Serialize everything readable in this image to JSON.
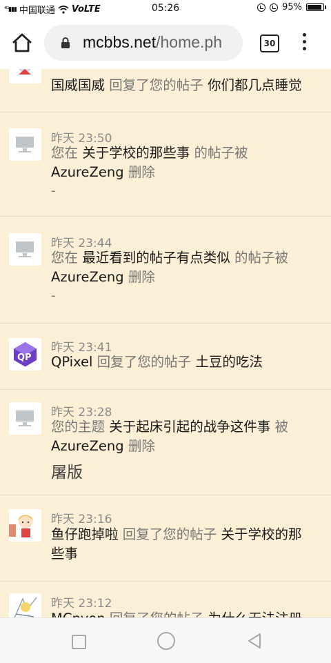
{
  "status": {
    "carrier": "中国联通",
    "volte": "VoLTE",
    "time": "05:26",
    "battery": "95%",
    "battery_level": 0.95
  },
  "browser": {
    "url_host": "mcbbs.net",
    "url_path": "/home.ph",
    "tab_count": "30"
  },
  "notifications": [
    {
      "avatar": "mascot",
      "time": "",
      "actor": "国威国威",
      "action": "回复了您的帖子",
      "target": "你们都几点睡觉",
      "line2": "",
      "note": ""
    },
    {
      "avatar": "monitor",
      "time": "昨天 23:50",
      "prefix": "您在",
      "target": "关于学校的那些事",
      "suffix": "的帖子被",
      "actor": "AzureZeng",
      "action": "删除",
      "note": "-"
    },
    {
      "avatar": "monitor",
      "time": "昨天 23:44",
      "prefix": "您在",
      "target": "最近看到的帖子有点类似",
      "suffix": "的帖子被",
      "actor": "AzureZeng",
      "action": "删除",
      "note": "-"
    },
    {
      "avatar": "qpixel",
      "time": "昨天 23:41",
      "actor": "QPixel",
      "action": "回复了您的帖子",
      "target": "土豆的吃法"
    },
    {
      "avatar": "monitor",
      "time": "昨天 23:28",
      "prefix": "您的主题",
      "target": "关于起床引起的战争这件事",
      "suffix": "被",
      "actor": "AzureZeng",
      "action": "删除",
      "note": "屠版"
    },
    {
      "avatar": "girl",
      "time": "昨天 23:16",
      "actor": "鱼仔跑掉啦",
      "action": "回复了您的帖子",
      "target": "关于学校的那",
      "target2": "些事"
    },
    {
      "avatar": "sketch",
      "time": "昨天 23:12",
      "actor": "MCpyon",
      "action": "回复了您的帖子",
      "target": "为什么无法注册"
    }
  ],
  "nav": {
    "recents": "recents-square-icon",
    "home": "home-circle-icon",
    "back": "back-triangle-icon"
  }
}
